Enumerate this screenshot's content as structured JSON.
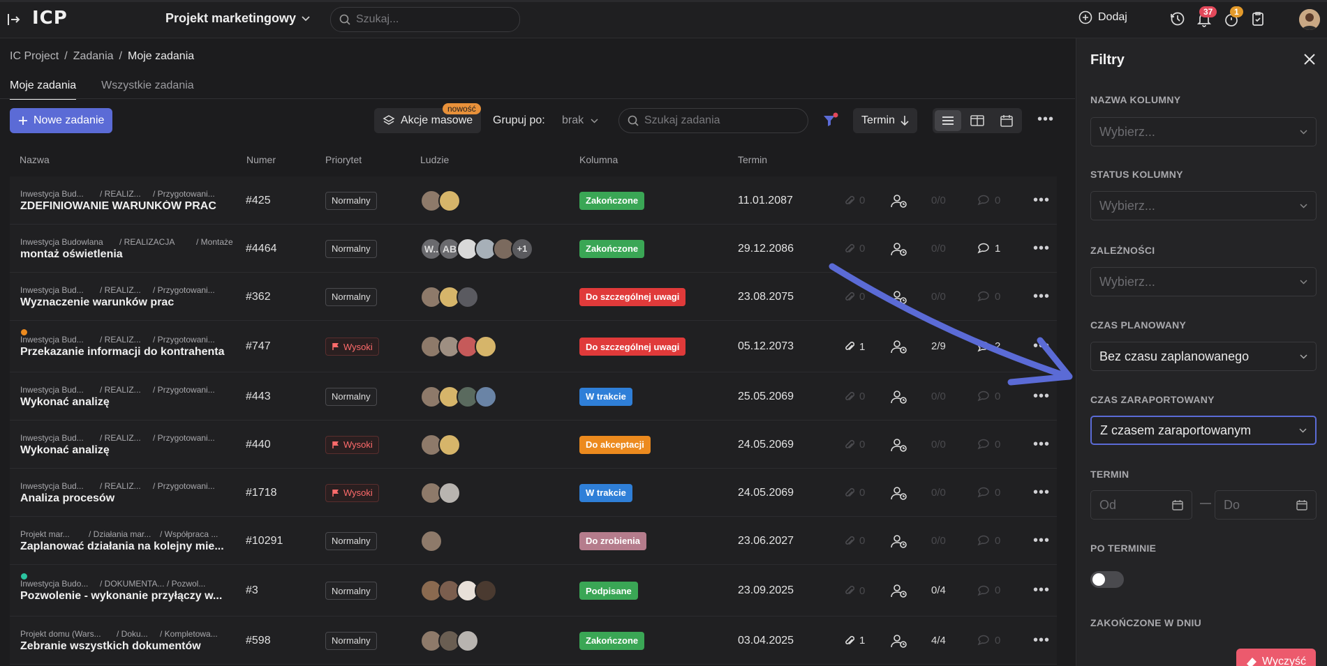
{
  "topbar": {
    "logo": "ICP",
    "project": "Projekt marketingowy",
    "search_placeholder": "Szukaj...",
    "add_label": "Dodaj",
    "notifications_count": "37",
    "updates_count": "1"
  },
  "breadcrumb": [
    "IC Project",
    "Zadania",
    "Moje zadania"
  ],
  "tabs": [
    {
      "label": "Moje zadania",
      "active": true
    },
    {
      "label": "Wszystkie zadania",
      "active": false
    }
  ],
  "toolbar": {
    "new_task": "Nowe zadanie",
    "bulk_actions": "Akcje masowe",
    "new_badge": "nowość",
    "group_by_label": "Grupuj po:",
    "group_by_value": "brak",
    "search_placeholder": "Szukaj zadania",
    "sort_label": "Termin"
  },
  "columns": {
    "name": "Nazwa",
    "number": "Numer",
    "priority": "Priorytet",
    "people": "Ludzie",
    "column": "Kolumna",
    "term": "Termin"
  },
  "rows": [
    {
      "p1": "Inwestycja Bud...",
      "p2": "/ REALIZ...",
      "p3": "/ Przygotowani...",
      "title": "ZDEFINIOWANIE WARUNKÓW PRAC",
      "num": "#425",
      "prio": "Normalny",
      "status": "Zakończone",
      "term": "11.01.2087",
      "att": "0",
      "sub": "0/0",
      "com": "0"
    },
    {
      "p1": "Inwestycja Budowlana",
      "p2": "/ REALIZACJA",
      "p3": "/ Montaże",
      "title": "montaż oświetlenia",
      "num": "#4464",
      "prio": "Normalny",
      "status": "Zakończone",
      "term": "29.12.2086",
      "att": "0",
      "sub": "0/0",
      "com": "1",
      "initials": [
        "W..",
        "AB"
      ],
      "more": "+1"
    },
    {
      "p1": "Inwestycja Bud...",
      "p2": "/ REALIZ...",
      "p3": "/ Przygotowani...",
      "title": "Wyznaczenie warunków prac",
      "num": "#362",
      "prio": "Normalny",
      "status": "Do szczególnej uwagi",
      "term": "23.08.2075",
      "att": "0",
      "sub": "0/0",
      "com": "0"
    },
    {
      "p1": "Inwestycja Bud...",
      "p2": "/ REALIZ...",
      "p3": "/ Przygotowani...",
      "title": "Przekazanie informacji do kontrahenta",
      "num": "#747",
      "prio": "Wysoki",
      "status": "Do szczególnej uwagi",
      "term": "05.12.2073",
      "att": "1",
      "sub": "2/9",
      "com": "2"
    },
    {
      "p1": "Inwestycja Bud...",
      "p2": "/ REALIZ...",
      "p3": "/ Przygotowani...",
      "title": "Wykonać analizę",
      "num": "#443",
      "prio": "Normalny",
      "status": "W trakcie",
      "term": "25.05.2069",
      "att": "0",
      "sub": "0/0",
      "com": "0"
    },
    {
      "p1": "Inwestycja Bud...",
      "p2": "/ REALIZ...",
      "p3": "/ Przygotowani...",
      "title": "Wykonać analizę",
      "num": "#440",
      "prio": "Wysoki",
      "status": "Do akceptacji",
      "term": "24.05.2069",
      "att": "0",
      "sub": "0/0",
      "com": "0"
    },
    {
      "p1": "Inwestycja Bud...",
      "p2": "/ REALIZ...",
      "p3": "/ Przygotowani...",
      "title": "Analiza procesów",
      "num": "#1718",
      "prio": "Wysoki",
      "status": "W trakcie",
      "term": "24.05.2069",
      "att": "0",
      "sub": "0/0",
      "com": "0"
    },
    {
      "p1": "Projekt mar...",
      "p2": "/ Działania mar...",
      "p3": "/ Współpraca ...",
      "title": "Zaplanować działania na kolejny mie...",
      "num": "#10291",
      "prio": "Normalny",
      "status": "Do zrobienia",
      "term": "23.06.2027",
      "att": "0",
      "sub": "0/0",
      "com": "0"
    },
    {
      "p1": "Inwestycja Budo...",
      "p2": "/ DOKUMENTA...",
      "p3": "/ Pozwol...",
      "title": "Pozwolenie - wykonanie przyłączy w...",
      "num": "#3",
      "prio": "Normalny",
      "status": "Podpisane",
      "term": "23.09.2025",
      "att": "0",
      "sub": "0/4",
      "com": "0"
    },
    {
      "p1": "Projekt domu (Wars...",
      "p2": "/ Doku...",
      "p3": "/ Kompletowa...",
      "title": "Zebranie wszystkich dokumentów",
      "num": "#598",
      "prio": "Normalny",
      "status": "Zakończone",
      "term": "03.04.2025",
      "att": "1",
      "sub": "4/4",
      "com": "0"
    }
  ],
  "status_colors": {
    "Zakończone": "#3aa655",
    "Do szczególnej uwagi": "#e03a3a",
    "W trakcie": "#2f7fd8",
    "Do akceptacji": "#ec8a1e",
    "Do zrobienia": "#b57c8c",
    "Podpisane": "#3aa655"
  },
  "filters": {
    "title": "Filtry",
    "column_name_label": "NAZWA KOLUMNY",
    "column_name_value": "Wybierz...",
    "column_status_label": "STATUS KOLUMNY",
    "column_status_value": "Wybierz...",
    "dependencies_label": "ZALEŻNOŚCI",
    "dependencies_value": "Wybierz...",
    "planned_time_label": "CZAS PLANOWANY",
    "planned_time_value": "Bez czasu zaplanowanego",
    "reported_time_label": "CZAS ZARAPORTOWANY",
    "reported_time_value": "Z czasem zaraportowanym",
    "term_label": "TERMIN",
    "from_placeholder": "Od",
    "dash": "—",
    "to_placeholder": "Do",
    "overdue_label": "PO TERMINIE",
    "completed_on_label": "ZAKOŃCZONE W DNIU",
    "clear_label": "Wyczyść"
  },
  "accent_color": "#5b6bd6"
}
